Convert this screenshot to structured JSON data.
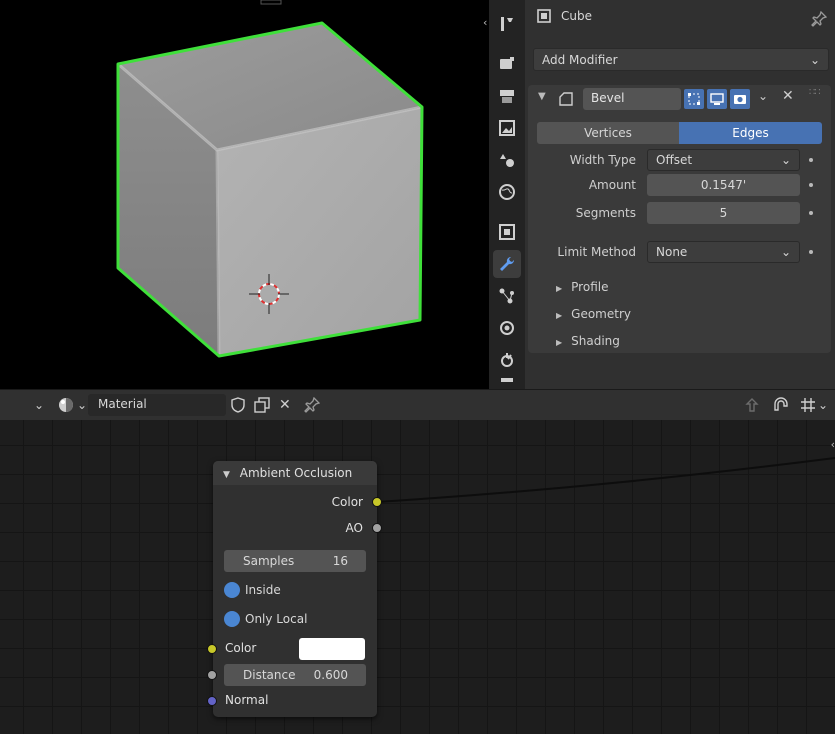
{
  "viewport": {},
  "properties": {
    "object_name": "Cube",
    "add_modifier_label": "Add Modifier",
    "modifier": {
      "name": "Bevel",
      "affect_tabs": [
        "Vertices",
        "Edges"
      ],
      "active_affect": "Edges",
      "width_type_label": "Width Type",
      "width_type_value": "Offset",
      "amount_label": "Amount",
      "amount_value": "0.1547'",
      "segments_label": "Segments",
      "segments_value": "5",
      "limit_method_label": "Limit Method",
      "limit_method_value": "None",
      "subpanels": [
        "Profile",
        "Geometry",
        "Shading"
      ]
    }
  },
  "node_editor": {
    "header": {
      "datablock_name": "Material"
    },
    "node": {
      "title": "Ambient Occlusion",
      "outputs": [
        "Color",
        "AO"
      ],
      "samples_label": "Samples",
      "samples_value": "16",
      "inside_label": "Inside",
      "only_local_label": "Only Local",
      "color_label": "Color",
      "distance_label": "Distance",
      "distance_value": "0.600",
      "normal_label": "Normal"
    }
  },
  "colors": {
    "selection_outline": "#3fe03a",
    "active_blue": "#4772b3",
    "socket_color": "#c7c729",
    "socket_float": "#a1a1a1",
    "socket_vector": "#6363c7"
  }
}
